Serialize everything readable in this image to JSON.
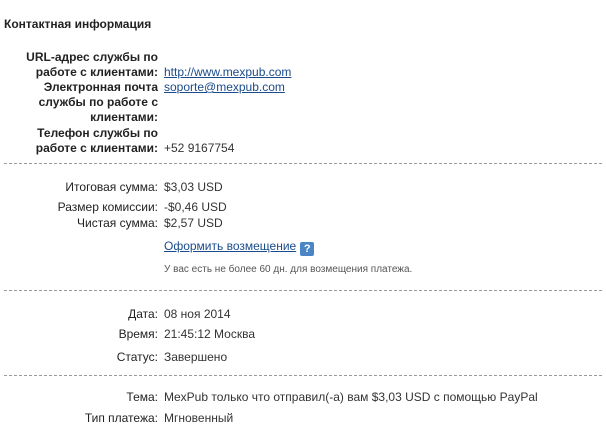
{
  "contact": {
    "title": "Контактная информация",
    "url_label": [
      "URL-адрес службы по",
      "работе с клиентами:"
    ],
    "url_value": "http://www.mexpub.com",
    "email_label": [
      "Электронная почта",
      "службы по работе с",
      "клиентами:"
    ],
    "email_value": "soporte@mexpub.com",
    "phone_label": [
      "Телефон службы по",
      "работе с клиентами:"
    ],
    "phone_value": "+52 9167754"
  },
  "amounts": {
    "total_label": "Итоговая сумма:",
    "total_value": "$3,03 USD",
    "fee_label": "Размер комиссии:",
    "fee_value": "-$0,46 USD",
    "net_label": "Чистая сумма:",
    "net_value": "$2,57 USD",
    "refund_link": "Оформить возмещение",
    "help_icon": "?",
    "refund_note": "У вас есть не более 60 дн. для возмещения платежа."
  },
  "details": {
    "date_label": "Дата:",
    "date_value": "08 ноя 2014",
    "time_label": "Время:",
    "time_value": "21:45:12 Москва",
    "status_label": "Статус:",
    "status_value": "Завершено"
  },
  "payment": {
    "subject_label": "Тема:",
    "subject_value": "MexPub только что отправил(-а) вам $3,03 USD с помощью PayPal",
    "type_label": "Тип платежа:",
    "type_value": "Мгновенный"
  }
}
